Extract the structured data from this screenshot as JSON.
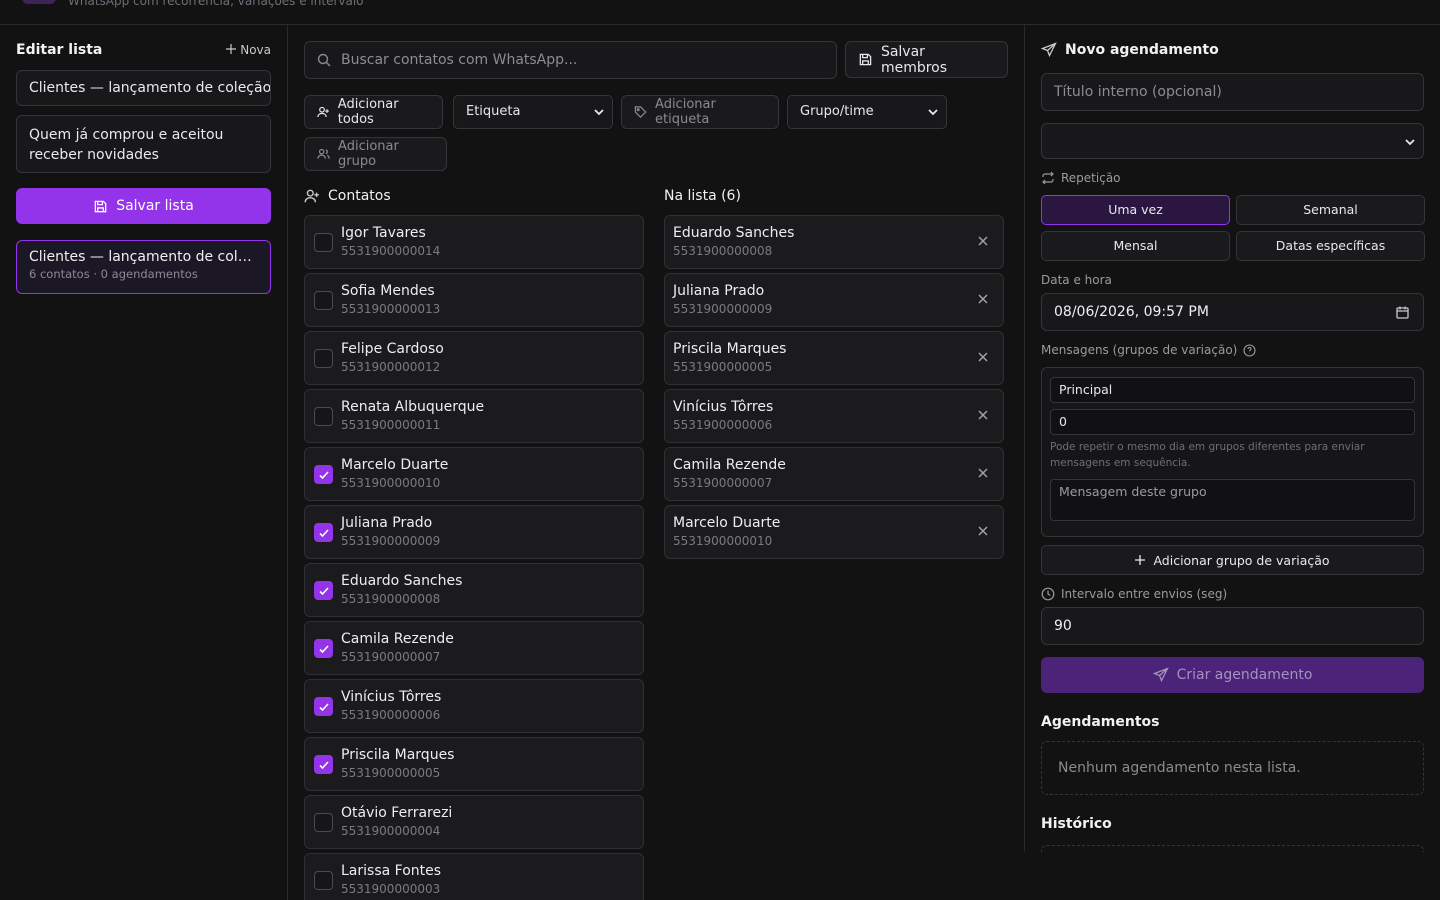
{
  "header": {
    "subtitle": "WhatsApp com recorrência, variações e intervalo"
  },
  "sidebar": {
    "title": "Editar lista",
    "new_label": "Nova",
    "name_value": "Clientes — lançamento de coleção",
    "description_value": "Quem já comprou e aceitou receber novidades",
    "save_label": "Salvar lista",
    "lists": [
      {
        "name": "Clientes — lançamento de coleção",
        "meta": "6 contatos · 0 agendamentos"
      }
    ]
  },
  "toolbar": {
    "search_placeholder": "Buscar contatos com WhatsApp...",
    "save_members_label": "Salvar membros",
    "add_all_label": "Adicionar todos",
    "tag_select": "Etiqueta",
    "add_tag_label": "Adicionar etiqueta",
    "group_select": "Grupo/time",
    "add_group_label": "Adicionar grupo"
  },
  "contacts": {
    "title": "Contatos",
    "items": [
      {
        "name": "Igor Tavares",
        "phone": "5531900000014",
        "checked": false
      },
      {
        "name": "Sofia Mendes",
        "phone": "5531900000013",
        "checked": false
      },
      {
        "name": "Felipe Cardoso",
        "phone": "5531900000012",
        "checked": false
      },
      {
        "name": "Renata Albuquerque",
        "phone": "5531900000011",
        "checked": false
      },
      {
        "name": "Marcelo Duarte",
        "phone": "5531900000010",
        "checked": true
      },
      {
        "name": "Juliana Prado",
        "phone": "5531900000009",
        "checked": true
      },
      {
        "name": "Eduardo Sanches",
        "phone": "5531900000008",
        "checked": true
      },
      {
        "name": "Camila Rezende",
        "phone": "5531900000007",
        "checked": true
      },
      {
        "name": "Vinícius Tôrres",
        "phone": "5531900000006",
        "checked": true
      },
      {
        "name": "Priscila Marques",
        "phone": "5531900000005",
        "checked": true
      },
      {
        "name": "Otávio Ferrarezi",
        "phone": "5531900000004",
        "checked": false
      },
      {
        "name": "Larissa Fontes",
        "phone": "5531900000003",
        "checked": false
      }
    ]
  },
  "in_list": {
    "title": "Na lista (6)",
    "items": [
      {
        "name": "Eduardo Sanches",
        "phone": "5531900000008"
      },
      {
        "name": "Juliana Prado",
        "phone": "5531900000009"
      },
      {
        "name": "Priscila Marques",
        "phone": "5531900000005"
      },
      {
        "name": "Vinícius Tôrres",
        "phone": "5531900000006"
      },
      {
        "name": "Camila Rezende",
        "phone": "5531900000007"
      },
      {
        "name": "Marcelo Duarte",
        "phone": "5531900000010"
      }
    ]
  },
  "schedule": {
    "title": "Novo agendamento",
    "title_placeholder": "Título interno (opcional)",
    "select_value": "",
    "repeat_label": "Repetição",
    "repeat_options": [
      "Uma vez",
      "Semanal",
      "Mensal",
      "Datas específicas"
    ],
    "repeat_selected": "Uma vez",
    "datetime_label": "Data e hora",
    "datetime_value": "08/06/2026, 09:57 PM",
    "messages_label": "Mensagens (grupos de variação)",
    "variant_name": "Principal",
    "variant_day": "0",
    "variant_hint": "Pode repetir o mesmo dia em grupos diferentes para enviar mensagens em sequência.",
    "variant_message_placeholder": "Mensagem deste grupo",
    "add_variant_label": "Adicionar grupo de variação",
    "interval_label": "Intervalo entre envios (seg)",
    "interval_value": "90",
    "create_label": "Criar agendamento"
  },
  "schedules_section": {
    "title": "Agendamentos",
    "empty": "Nenhum agendamento nesta lista."
  },
  "history_section": {
    "title": "Histórico"
  },
  "colors": {
    "accent": "#9333ea",
    "background": "#121212",
    "surface": "#1b1b1e"
  },
  "icons": [
    "save-icon",
    "plus-icon",
    "search-icon",
    "user-plus-icon",
    "tag-icon",
    "users-icon",
    "check-icon",
    "close-icon",
    "send-icon",
    "repeat-icon",
    "calendar-icon",
    "help-icon",
    "clock-icon",
    "chevron-down-icon"
  ]
}
